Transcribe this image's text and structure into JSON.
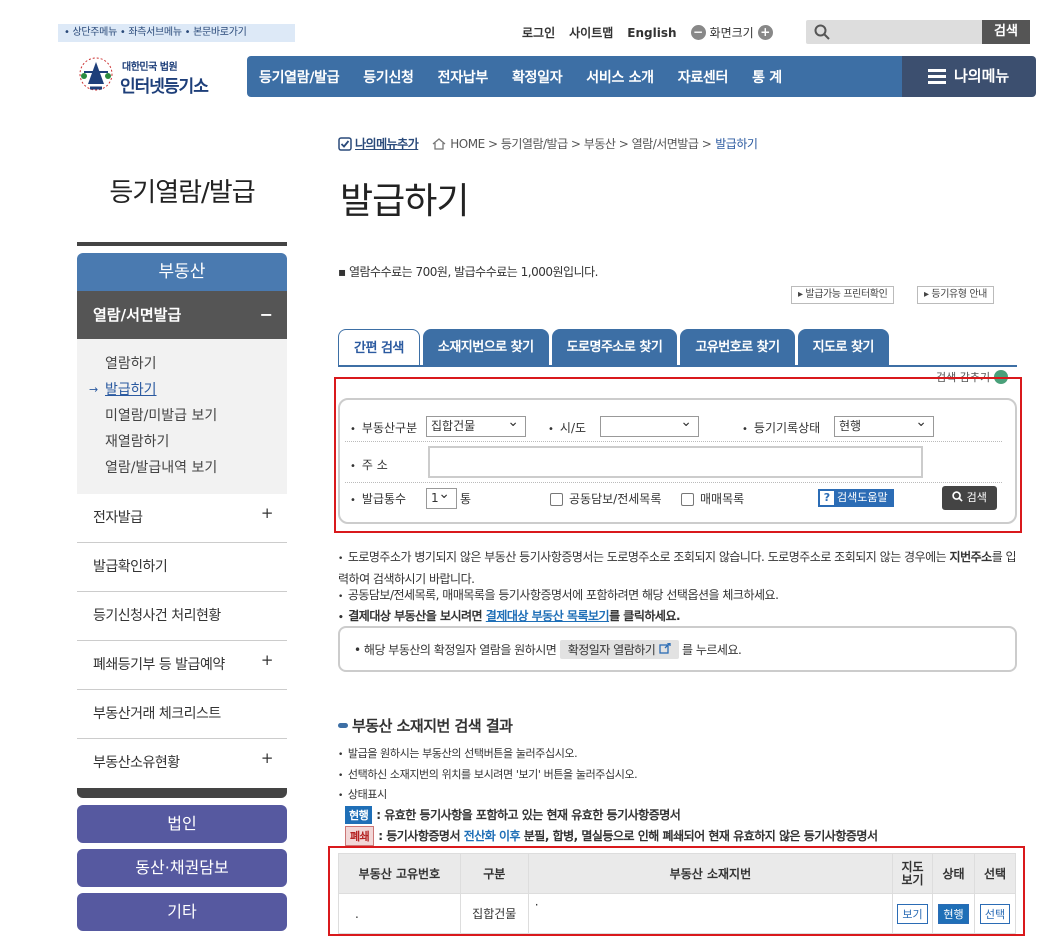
{
  "skip_links": "• 상단주메뉴 • 좌측서브메뉴 • 본문바로가기",
  "logo": {
    "small": "대한민국 법원",
    "main": "인터넷등기소"
  },
  "top_links": {
    "login": "로그인",
    "sitemap": "사이트맵",
    "english": "English",
    "zoom": "화면크기",
    "minus": "−",
    "plus": "+"
  },
  "search": {
    "button": "검색",
    "placeholder": ""
  },
  "gnb": [
    "등기열람/발급",
    "등기신청",
    "전자납부",
    "확정일자",
    "서비스 소개",
    "자료센터",
    "통 계"
  ],
  "mymenu": "나의메뉴",
  "lnb": {
    "title": "등기열람/발급",
    "head": "부동산",
    "selected": "열람/서면발급",
    "selected_sign": "−",
    "sub": [
      "열람하기",
      "발급하기",
      "미열람/미발급 보기",
      "재열람하기",
      "열람/발급내역 보기"
    ],
    "items": [
      {
        "label": "전자발급",
        "sign": "+"
      },
      {
        "label": "발급확인하기",
        "sign": ""
      },
      {
        "label": "등기신청사건 처리현황",
        "sign": ""
      },
      {
        "label": "폐쇄등기부 등 발급예약",
        "sign": "+"
      },
      {
        "label": "부동산거래 체크리스트",
        "sign": ""
      },
      {
        "label": "부동산소유현황",
        "sign": "+"
      }
    ],
    "buttons": [
      "법인",
      "동산·채권담보",
      "기타"
    ]
  },
  "breadcrumb": {
    "add": "나의메뉴추가",
    "path": "HOME > 등기열람/발급 > 부동산 > 열람/서면발급 >",
    "current": "발급하기"
  },
  "page_title": "발급하기",
  "fee_note": "열람수수료는 700원, 발급수수료는 1,000원입니다.",
  "small_buttons": [
    "발급가능 프린터확인",
    "등기유형 안내"
  ],
  "tabs": [
    "간편 검색",
    "소재지번으로 찾기",
    "도로명주소로 찾기",
    "고유번호로 찾기",
    "지도로 찾기"
  ],
  "search_close": "검색 감추기",
  "form": {
    "type_label": "부동산구분",
    "type_value": "집합건물",
    "city_label": "시/도",
    "city_value": "",
    "status_label": "등기기록상태",
    "status_value": "현행",
    "addr_label": "주 소",
    "addr_value": "",
    "count_label": "발급통수",
    "count_value": "1",
    "count_unit": "통",
    "opt1": "공동담보/전세목록",
    "opt2": "매매목록",
    "help": "검색도움말",
    "help_icon": "?",
    "search_btn": "검색"
  },
  "notes": {
    "n1a": "도로명주소가 병기되지 않은 부동산 등기사항증명서는 도로명주소로 조회되지 않습니다. 도로명주소로 조회되지 않는 경우에는 ",
    "n1b": "지번주소",
    "n1c": "를 입력하여 검색하시기 바랍니다.",
    "n2": "공동담보/전세목록, 매매목록을 등기사항증명서에 포함하려면 해당 선택옵션을 체크하세요.",
    "n3a": "결제대상 부동산을 보시려면 ",
    "n3b": "결제대상 부동산 목록보기",
    "n3c": "를 클릭하세요."
  },
  "box2": {
    "pre": "해당 부동산의 확정일자 열람을 원하시면",
    "btn": "확정일자 열람하기",
    "post": "를 누르세요."
  },
  "result": {
    "title": "부동산 소재지번 검색 결과",
    "n1": "발급을 원하시는 부동산의 선택버튼을 눌러주십시오.",
    "n2": "선택하신 소재지번의 위치를 보시려면 '보기' 버튼을 눌러주십시오.",
    "n3": "상태표시",
    "leg1_badge": "현행",
    "leg1": ": 유효한 등기사항을 포함하고 있는 현재 유효한 등기사항증명서",
    "leg2_badge": "폐쇄",
    "leg2a": ": 등기사항증명서 ",
    "leg2b": "전산화 이후",
    "leg2c": " 분필, 합병, 멸실등으로 인해 폐쇄되어 현재 유효하지 않은 등기사항증명서",
    "headers": [
      "부동산 고유번호",
      "구분",
      "부동산 소재지번",
      "지도\n보기",
      "상태",
      "선택"
    ],
    "row": {
      "id": ".",
      "kind": "집합건물",
      "addr": "·",
      "map": "보기",
      "status": "현행",
      "select": "선택"
    }
  },
  "colors": {
    "primary": "#3d6fa5",
    "highlight": "#d9191c",
    "lnb_button": "#5659a0"
  }
}
